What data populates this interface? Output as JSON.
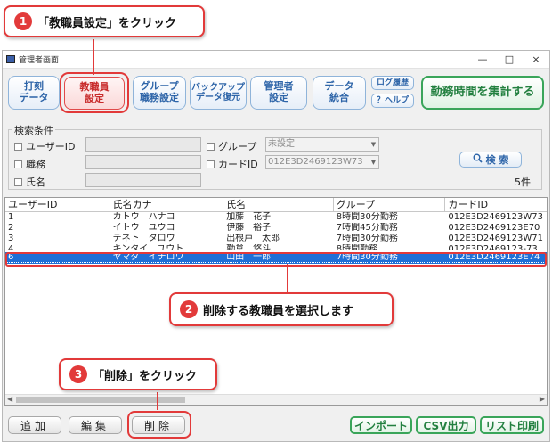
{
  "callouts": {
    "step1": {
      "num": "1",
      "text": "「教職員設定」をクリック"
    },
    "step2": {
      "num": "2",
      "text": "削除する教職員を選択します"
    },
    "step3": {
      "num": "3",
      "text": "「削除」をクリック"
    }
  },
  "window": {
    "title": "管理者画面",
    "controls": {
      "minimize": "—",
      "maximize": "□",
      "close": "×"
    }
  },
  "toolbar": {
    "punch": "打刻\nデータ",
    "staff": "教職員\n設定",
    "group": "グループ\n職務設定",
    "backup": "バックアップ\nデータ復元",
    "admin": "管理者\n設定",
    "data_merge": "データ\n統合",
    "log": "ログ履歴",
    "help": "？ヘルプ",
    "aggregate": "勤務時間を集計する"
  },
  "search": {
    "legend": "検索条件",
    "user_id_label": "ユーザーID",
    "position_label": "職務",
    "name_label": "氏名",
    "group_label": "グループ",
    "group_value": "未設定",
    "card_label": "カードID",
    "card_value": "012E3D2469123W73",
    "search_button": "検 索",
    "count": "5件"
  },
  "table": {
    "headers": [
      "ユーザーID",
      "氏名カナ",
      "氏名",
      "グループ",
      "カードID"
    ],
    "rows": [
      [
        "1",
        "カトウ　ハナコ",
        "加藤　花子",
        "8時間30分勤務",
        "012E3D2469123W73"
      ],
      [
        "2",
        "イトウ　ユウコ",
        "伊藤　裕子",
        "7時間45分勤務",
        "012E3D2469123E70"
      ],
      [
        "3",
        "デネト　タロウ",
        "出根戸　太郎",
        "7時間30分勤務",
        "012E3D2469123W71"
      ],
      [
        "4",
        "キンタイ　ユウト",
        "勤怠　悠斗",
        "8時間勤務",
        "012E3D2469123-73"
      ],
      [
        "6",
        "ヤマダ　イチロウ",
        "山田　一郎",
        "7時間30分勤務",
        "012E3D2469123E74"
      ]
    ]
  },
  "bottom": {
    "add": "追加",
    "edit": "編集",
    "delete": "削除",
    "import": "インポート",
    "csv": "CSV出力",
    "print": "リスト印刷"
  }
}
